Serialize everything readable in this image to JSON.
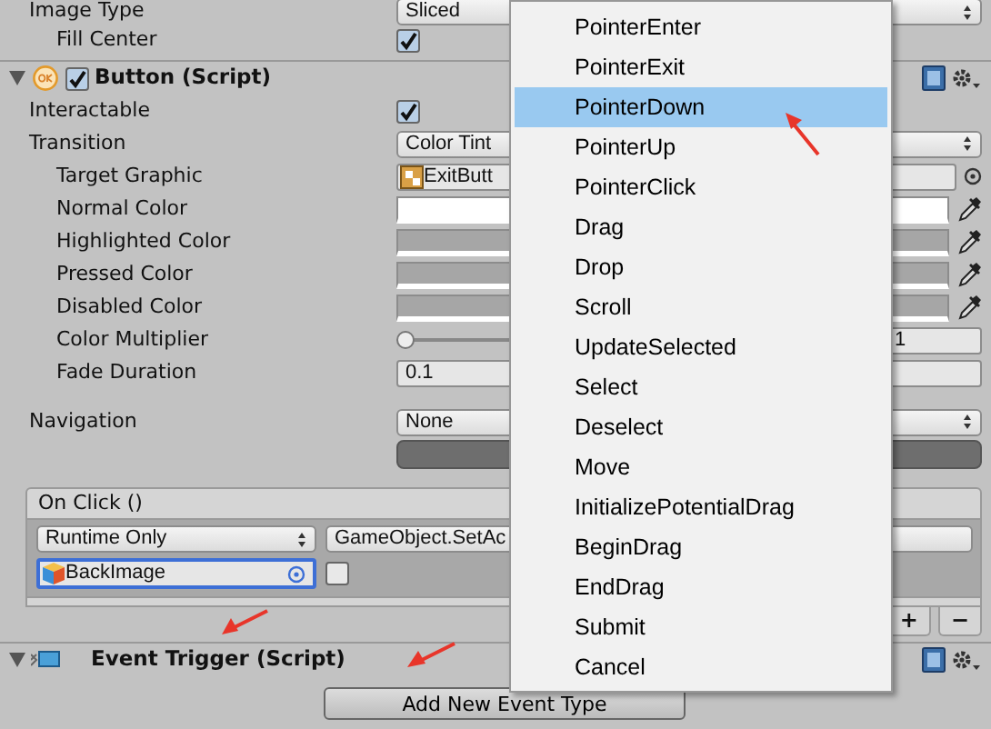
{
  "image_properties": [
    {
      "label": "Image Type",
      "kind": "dropdown",
      "value": "Sliced",
      "children": [
        {
          "label": "Fill Center",
          "kind": "checkbox",
          "checked": true
        }
      ]
    }
  ],
  "button_component": {
    "title": "Button (Script)",
    "enabled": true,
    "expanded": true,
    "properties": [
      {
        "label": "Interactable",
        "kind": "checkbox",
        "checked": true
      },
      {
        "label": "Transition",
        "kind": "dropdown",
        "value": "Color Tint",
        "children": [
          {
            "label": "Target Graphic",
            "kind": "object",
            "value": "ExitButt"
          },
          {
            "label": "Normal Color",
            "kind": "color",
            "color": "#ffffff"
          },
          {
            "label": "Highlighted Color",
            "kind": "color",
            "color": "#a6a6a6"
          },
          {
            "label": "Pressed Color",
            "kind": "color",
            "color": "#a6a6a6"
          },
          {
            "label": "Disabled Color",
            "kind": "color",
            "color": "#a6a6a6"
          },
          {
            "label": "Color Multiplier",
            "kind": "slider",
            "level": 0,
            "value": "1"
          },
          {
            "label": "Fade Duration",
            "kind": "number",
            "value": "0.1"
          }
        ]
      },
      {
        "label": "Navigation",
        "kind": "dropdown",
        "value": "None"
      }
    ]
  },
  "on_click": {
    "title": "On Click ()",
    "listeners": [
      {
        "mode": "Runtime Only",
        "function": "GameObject.SetAc",
        "target": "BackImage",
        "target_selected": true,
        "checked": false
      }
    ],
    "add_label": "+",
    "remove_label": "−"
  },
  "event_trigger": {
    "title": "Event Trigger (Script)",
    "expanded": true,
    "add_button": "Add New Event Type"
  },
  "menu": {
    "items": [
      {
        "label": "PointerEnter",
        "selected": false
      },
      {
        "label": "PointerExit",
        "selected": false
      },
      {
        "label": "PointerDown",
        "selected": true
      },
      {
        "label": "PointerUp",
        "selected": false
      },
      {
        "label": "PointerClick",
        "selected": false
      },
      {
        "label": "Drag",
        "selected": false
      },
      {
        "label": "Drop",
        "selected": false
      },
      {
        "label": "Scroll",
        "selected": false
      },
      {
        "label": "UpdateSelected",
        "selected": false
      },
      {
        "label": "Select",
        "selected": false
      },
      {
        "label": "Deselect",
        "selected": false
      },
      {
        "label": "Move",
        "selected": false
      },
      {
        "label": "InitializePotentialDrag",
        "selected": false
      },
      {
        "label": "BeginDrag",
        "selected": false
      },
      {
        "label": "EndDrag",
        "selected": false
      },
      {
        "label": "Submit",
        "selected": false
      },
      {
        "label": "Cancel",
        "selected": false
      }
    ]
  }
}
